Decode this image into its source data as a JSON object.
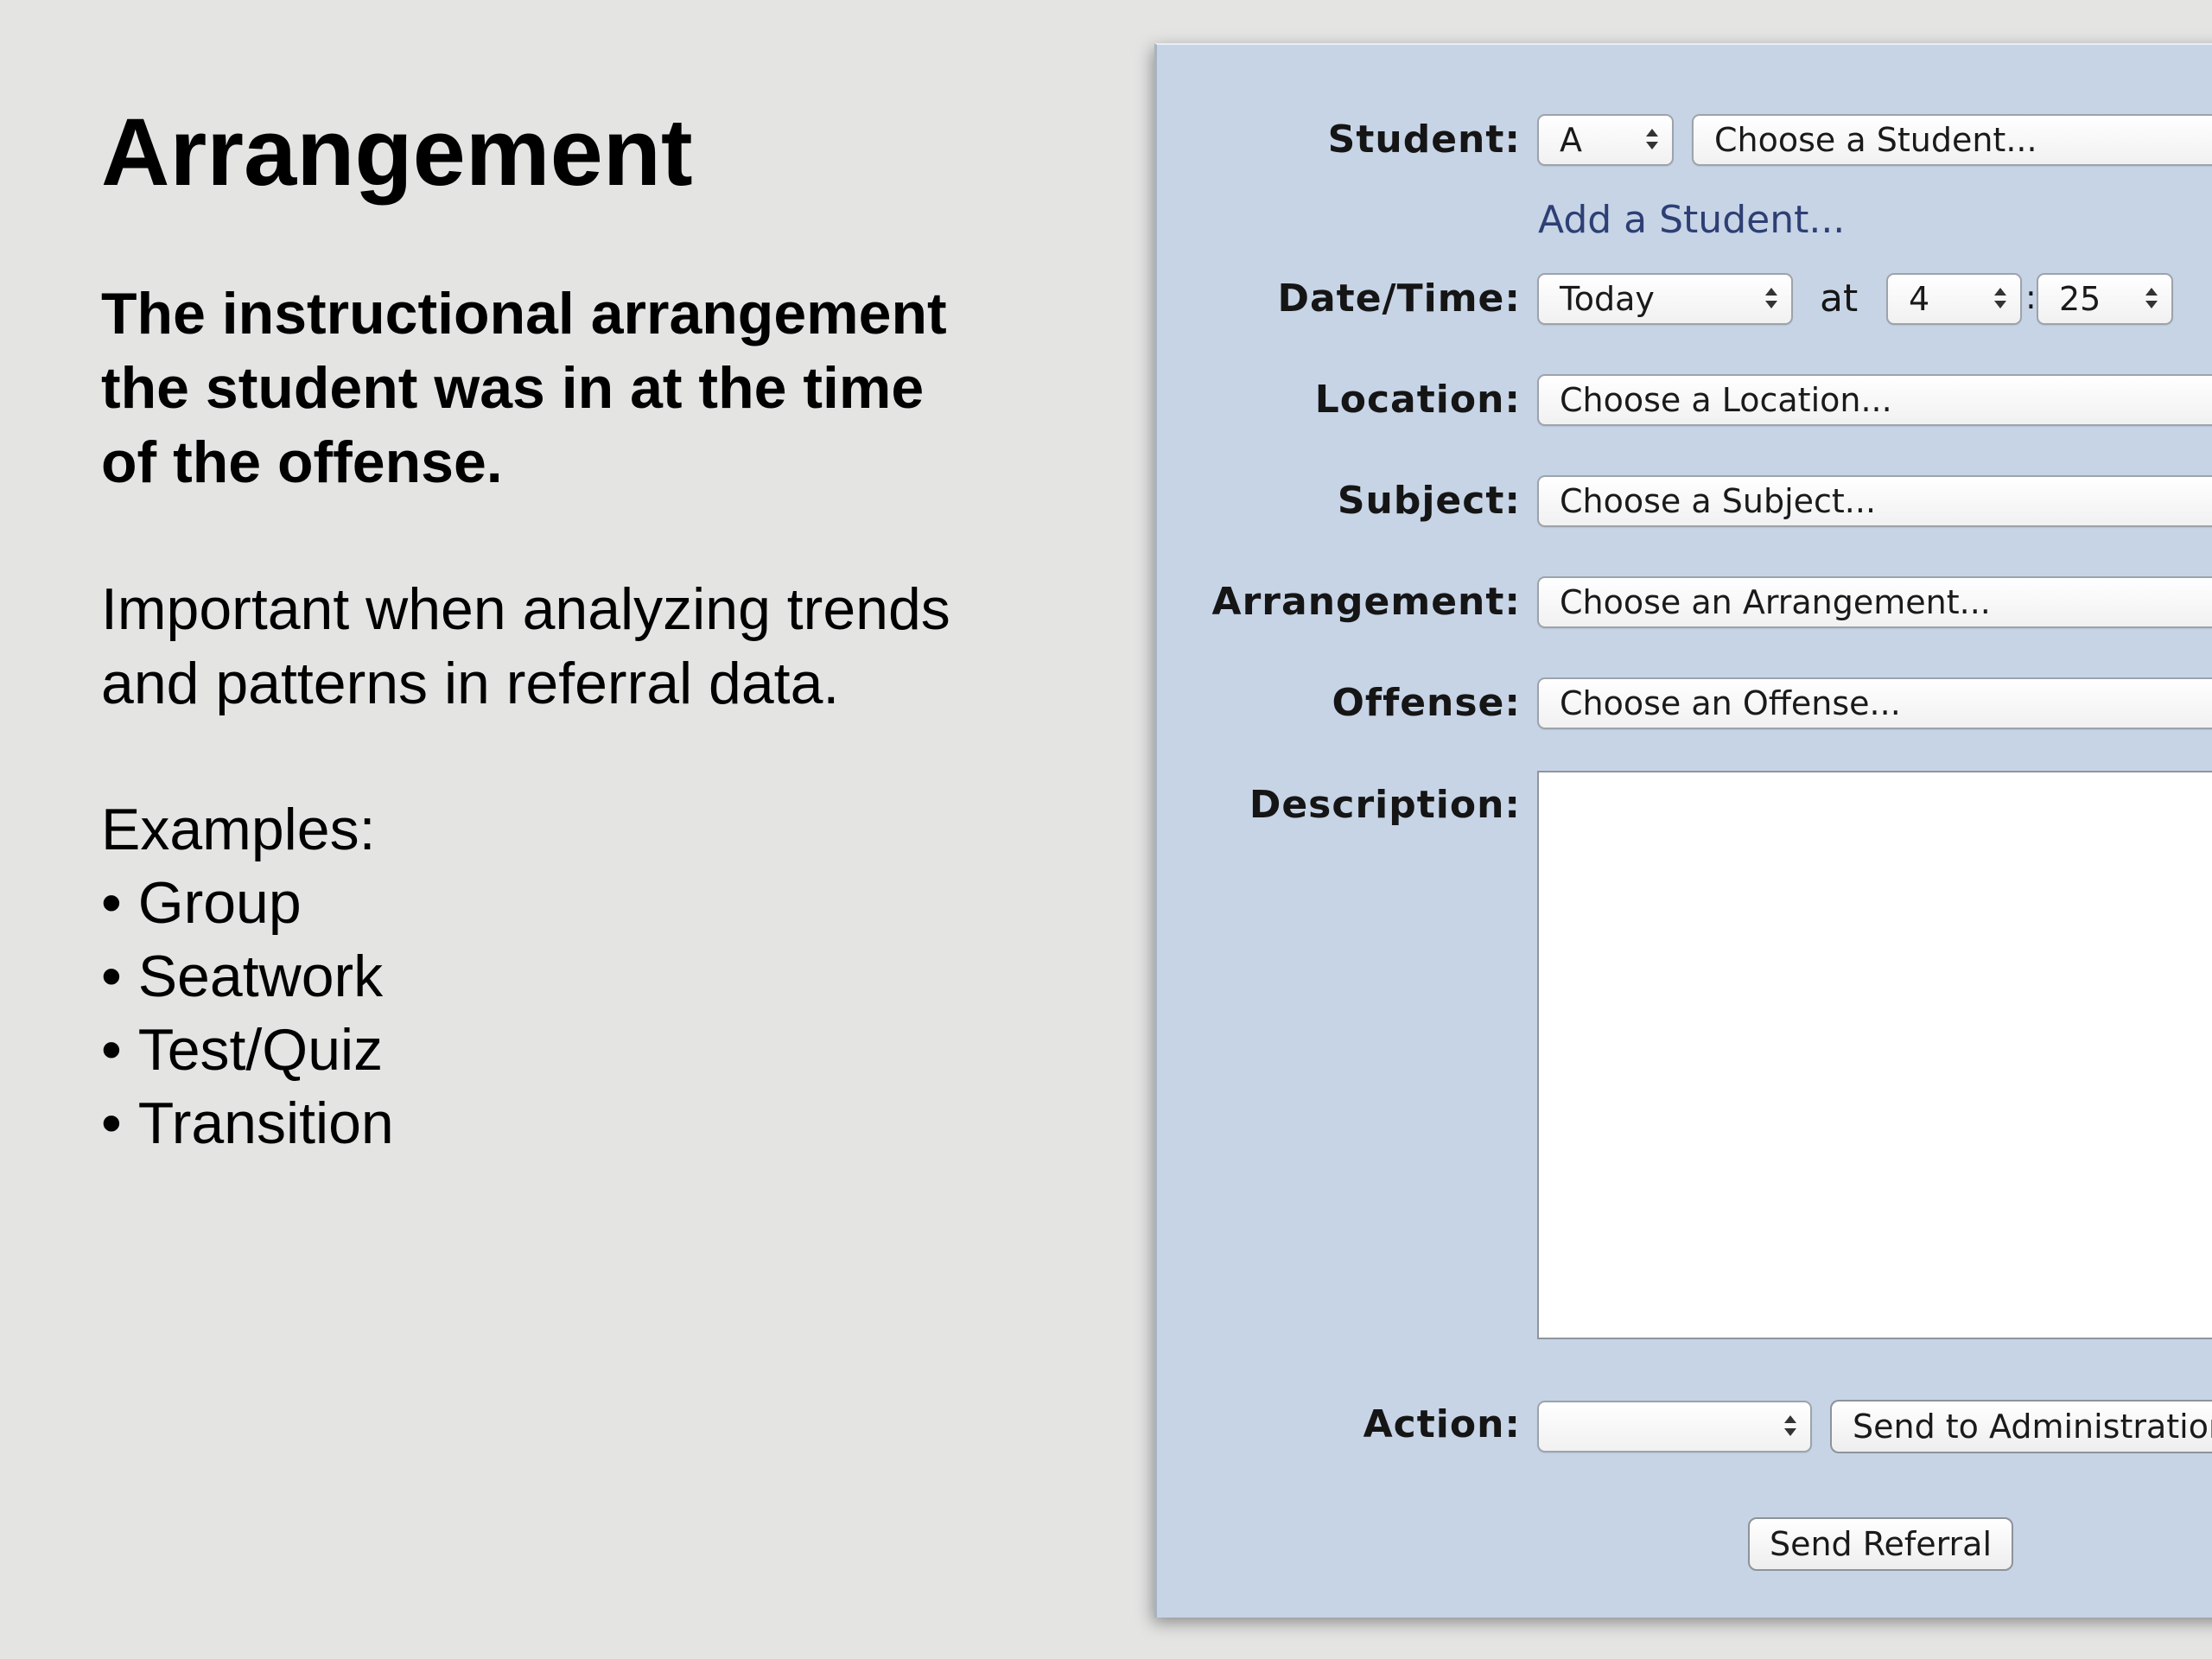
{
  "slide": {
    "title": "Arrangement",
    "definition_lines": [
      "The instructional arrangement",
      "the student was in at the time",
      "of the offense."
    ],
    "importance_lines": [
      "Important when analyzing trends",
      "and patterns in referral data."
    ],
    "examples_heading": "Examples:",
    "examples": [
      "Group",
      "Seatwork",
      "Test/Quiz",
      "Transition"
    ]
  },
  "form": {
    "student": {
      "label": "Student:",
      "letter_value": "A",
      "student_value": "Choose a Student...",
      "add_link": "Add a Student..."
    },
    "datetime": {
      "label": "Date/Time:",
      "day_value": "Today",
      "at_text": "at",
      "hour_value": "4",
      "separator": ":",
      "minute_value": "25"
    },
    "location": {
      "label": "Location:",
      "value": "Choose a Location..."
    },
    "subject": {
      "label": "Subject:",
      "value": "Choose a Subject..."
    },
    "arrangement": {
      "label": "Arrangement:",
      "value": "Choose an Arrangement..."
    },
    "offense": {
      "label": "Offense:",
      "value": "Choose an Offense..."
    },
    "description": {
      "label": "Description:",
      "value": ""
    },
    "action": {
      "label": "Action:",
      "value": "",
      "send_admin_label": "Send to Administration"
    },
    "send_referral_label": "Send Referral"
  }
}
